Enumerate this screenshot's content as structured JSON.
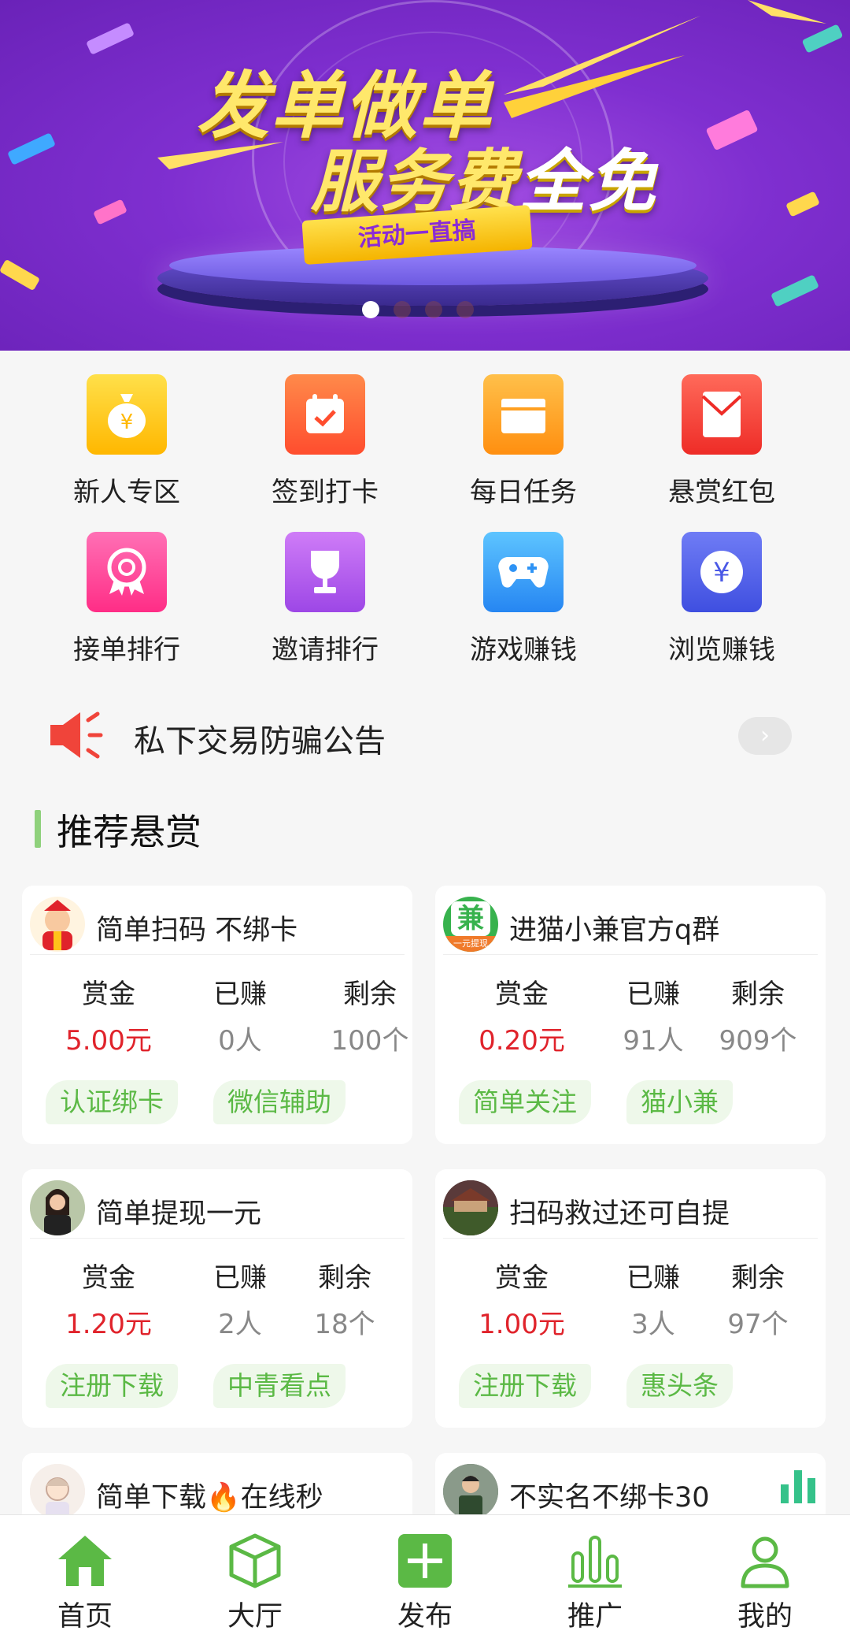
{
  "banner": {
    "headline_line1": "发单做单",
    "headline_line2_prefix": "服务费",
    "headline_line2_highlight": "全免",
    "ribbon": "活动一直搞",
    "slide_count": 4,
    "active_slide": 1
  },
  "grid": [
    {
      "label": "新人专区",
      "icon": "money-bag-icon",
      "color": "#ffc21a"
    },
    {
      "label": "签到打卡",
      "icon": "calendar-check-icon",
      "color": "#ff6a3d"
    },
    {
      "label": "每日任务",
      "icon": "task-box-icon",
      "color": "#ffa11d"
    },
    {
      "label": "悬赏红包",
      "icon": "red-envelope-icon",
      "color": "#f6453a"
    },
    {
      "label": "接单排行",
      "icon": "medal-icon",
      "color": "#ff4f9a"
    },
    {
      "label": "邀请排行",
      "icon": "trophy-icon",
      "color": "#b55ef0"
    },
    {
      "label": "游戏赚钱",
      "icon": "gamepad-icon",
      "color": "#3aa5f8"
    },
    {
      "label": "浏览赚钱",
      "icon": "yen-coin-icon",
      "color": "#5663ea"
    }
  ],
  "notice": {
    "text": "私下交易防骗公告"
  },
  "section": {
    "title": "推荐悬赏"
  },
  "stat_labels": {
    "reward": "赏金",
    "earned": "已赚",
    "remaining": "剩余"
  },
  "cards": [
    {
      "title": "简单扫码 不绑卡",
      "reward": "5.00元",
      "earned": "0人",
      "remaining": "100个",
      "tags": [
        "认证绑卡",
        "微信辅助"
      ]
    },
    {
      "title": "进猫小兼官方q群",
      "reward": "0.20元",
      "earned": "91人",
      "remaining": "909个",
      "tags": [
        "简单关注",
        "猫小兼"
      ],
      "avatar_text": "兼",
      "avatar_sub": "一元提现"
    },
    {
      "title": "简单提现一元",
      "reward": "1.20元",
      "earned": "2人",
      "remaining": "18个",
      "tags": [
        "注册下载",
        "中青看点"
      ]
    },
    {
      "title": "扫码救过还可自提",
      "reward": "1.00元",
      "earned": "3人",
      "remaining": "97个",
      "tags": [
        "注册下载",
        "惠头条"
      ]
    },
    {
      "title": "简单下载🔥在线秒"
    },
    {
      "title": "不实名不绑卡30"
    }
  ],
  "tabs": [
    {
      "label": "首页",
      "icon": "home-icon"
    },
    {
      "label": "大厅",
      "icon": "cube-icon"
    },
    {
      "label": "发布",
      "icon": "plus-square-icon"
    },
    {
      "label": "推广",
      "icon": "bar-chart-icon"
    },
    {
      "label": "我的",
      "icon": "user-icon"
    }
  ],
  "colors": {
    "accent_green": "#5bb945",
    "reward_red": "#e0232b",
    "banner_purple": "#7f2fd0"
  }
}
